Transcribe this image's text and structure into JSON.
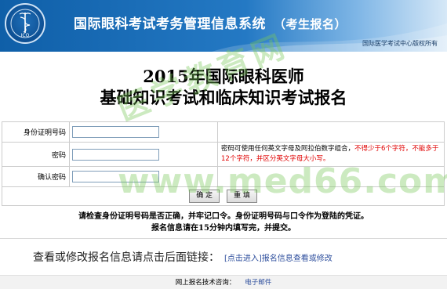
{
  "header": {
    "system_title": "国际眼科考试考务管理信息系统",
    "system_subtitle": "（考生报名）",
    "copyright": "国际医学考试中心版权所有",
    "logo_text": "ICO"
  },
  "page": {
    "title_line1": "2015年国际眼科医师",
    "title_line2": "基础知识考试和临床知识考试报名"
  },
  "form": {
    "id_label": "身份证明号码",
    "id_value": "",
    "password_label": "密码",
    "password_value": "",
    "confirm_label": "确认密码",
    "confirm_value": "",
    "password_note_part1": "密码可使用任何英文字母及阿拉伯数字组合，",
    "password_note_red": "不得少于6个字符，不能多于12个字符，并区分英文字母大小写。",
    "ok_button": "确 定",
    "reset_button": "重 填"
  },
  "notice": {
    "line1": "请检查身份证明号码是否正确，并牢记口令。身份证明号码与口令作为登陆的凭证。",
    "line2": "报名信息请在15分钟内填写完，并提交。"
  },
  "modify": {
    "text": "查看或修改报名信息请点击后面链接：",
    "link": "[点击进入]报名信息查看或修改"
  },
  "footer": {
    "support_text": "网上报名技术咨询：",
    "email_link": "电子邮件"
  },
  "watermark": {
    "cn": "医学教育网",
    "url": "www.med66.com"
  },
  "colors": {
    "header_blue": "#0f5fa8",
    "warning_red": "#e00000",
    "link_blue": "#2c4d9c",
    "watermark_green": "#78c85a"
  }
}
